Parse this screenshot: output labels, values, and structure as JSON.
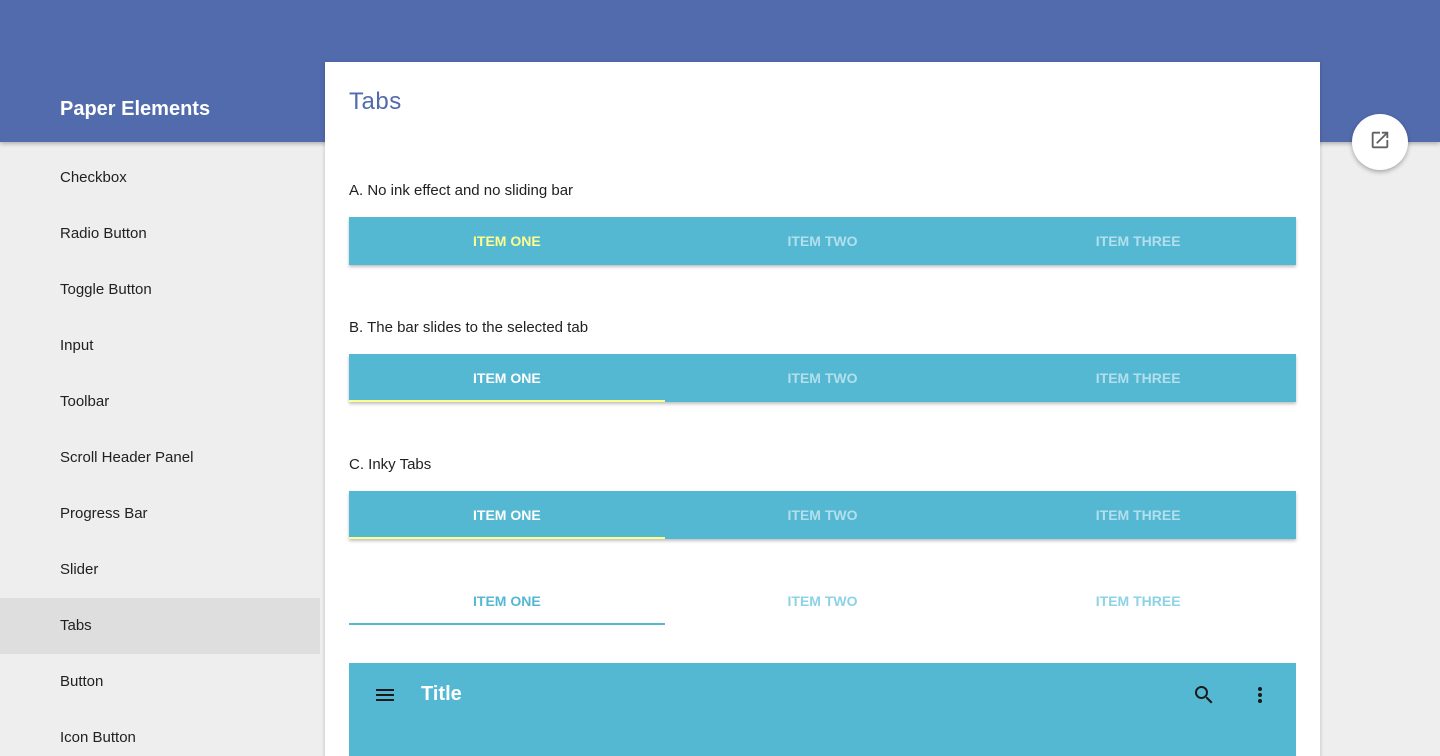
{
  "app": {
    "title": "Paper Elements"
  },
  "sidebar": {
    "items": [
      {
        "label": "Checkbox"
      },
      {
        "label": "Radio Button"
      },
      {
        "label": "Toggle Button"
      },
      {
        "label": "Input"
      },
      {
        "label": "Toolbar"
      },
      {
        "label": "Scroll Header Panel"
      },
      {
        "label": "Progress Bar"
      },
      {
        "label": "Slider"
      },
      {
        "label": "Tabs"
      },
      {
        "label": "Button"
      },
      {
        "label": "Icon Button"
      }
    ],
    "selected": "Tabs"
  },
  "page": {
    "title": "Tabs",
    "sections": [
      {
        "label": "A. No ink effect and no sliding bar",
        "tabs": [
          "ITEM ONE",
          "ITEM TWO",
          "ITEM THREE"
        ]
      },
      {
        "label": "B. The bar slides to the selected tab",
        "tabs": [
          "ITEM ONE",
          "ITEM TWO",
          "ITEM THREE"
        ]
      },
      {
        "label": "C. Inky Tabs",
        "tabs": [
          "ITEM ONE",
          "ITEM TWO",
          "ITEM THREE"
        ]
      },
      {
        "label": "",
        "tabs": [
          "ITEM ONE",
          "ITEM TWO",
          "ITEM THREE"
        ]
      }
    ],
    "toolbar": {
      "title": "Title",
      "icons": [
        "menu-icon",
        "search-icon",
        "more-vert-icon"
      ]
    }
  },
  "fab": {
    "icon": "open-in-new-icon"
  },
  "colors": {
    "header": "#526bad",
    "accent": "#55b8d3",
    "highlight": "#ffff8d",
    "selected_nav": "#dedede"
  }
}
